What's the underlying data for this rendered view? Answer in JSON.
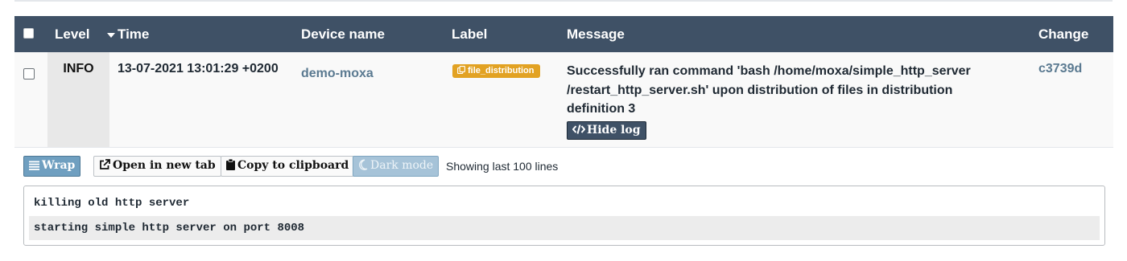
{
  "table": {
    "columns": {
      "level": "Level",
      "time": "Time",
      "device": "Device name",
      "label": "Label",
      "message": "Message",
      "change": "Change"
    },
    "sort": {
      "column": "time",
      "direction": "descending"
    },
    "rows": [
      {
        "selected": false,
        "level": "INFO",
        "time": "13-07-2021 13:01:29 +0200",
        "device": "demo-moxa",
        "label": "file_distribution",
        "label_icon": "file-copy-icon",
        "label_color": "#e2a223",
        "message": "Successfully ran command 'bash /home/moxa/simple_http_server /restart_http_server.sh' upon distribution of files in distribution definition 3",
        "hide_log_label": "Hide log",
        "hide_log_icon": "code-icon",
        "change": "c3739d"
      }
    ]
  },
  "log_toolbar": {
    "wrap_label": "Wrap",
    "wrap_icon": "lines-icon",
    "open_tab_label": "Open in new tab",
    "open_tab_icon": "external-link-icon",
    "copy_label": "Copy to clipboard",
    "copy_icon": "clipboard-icon",
    "dark_mode_label": "Dark mode",
    "dark_mode_icon": "moon-icon",
    "showing_text": "Showing last 100 lines"
  },
  "log_lines": [
    "killing old http server",
    "starting simple http server on port 8008"
  ],
  "colors": {
    "header_bg": "#3f5166",
    "link": "#5b7a91",
    "label_badge": "#e2a223",
    "active_button": "#6f9fc0"
  }
}
